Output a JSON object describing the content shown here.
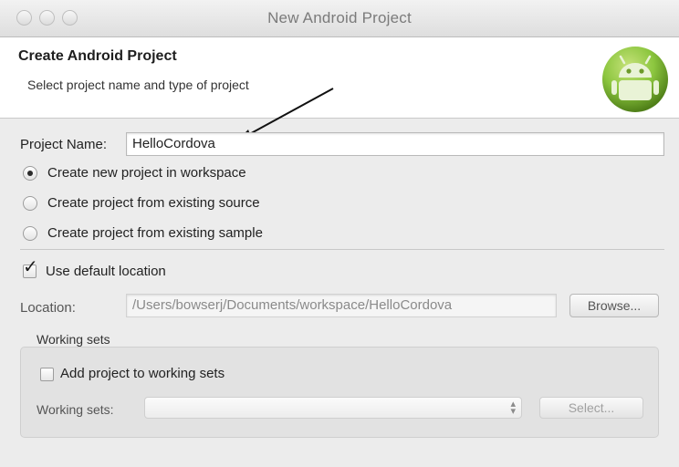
{
  "window": {
    "title": "New Android Project"
  },
  "header": {
    "title": "Create Android Project",
    "subtitle": "Select project name and type of project"
  },
  "project_name": {
    "label": "Project Name:",
    "value": "HelloCordova"
  },
  "source_options": [
    {
      "label": "Create new project in workspace",
      "selected": true
    },
    {
      "label": "Create project from existing source",
      "selected": false
    },
    {
      "label": "Create project from existing sample",
      "selected": false
    }
  ],
  "default_location": {
    "label": "Use default location",
    "checked": true
  },
  "location": {
    "label": "Location:",
    "value": "/Users/bowserj/Documents/workspace/HelloCordova",
    "browse_label": "Browse..."
  },
  "working_sets": {
    "group_title": "Working sets",
    "add_label": "Add project to working sets",
    "add_checked": false,
    "select_label": "Working sets:",
    "select_value": "",
    "select_button_label": "Select..."
  },
  "colors": {
    "android_green": "#8cc63f",
    "android_green_dark": "#5f8f1f",
    "title_text": "#7b7b7b"
  },
  "icons": [
    "window-close-icon",
    "window-minimize-icon",
    "window-zoom-icon",
    "android-logo-icon",
    "annotation-arrow-icon",
    "select-arrows-icon"
  ]
}
